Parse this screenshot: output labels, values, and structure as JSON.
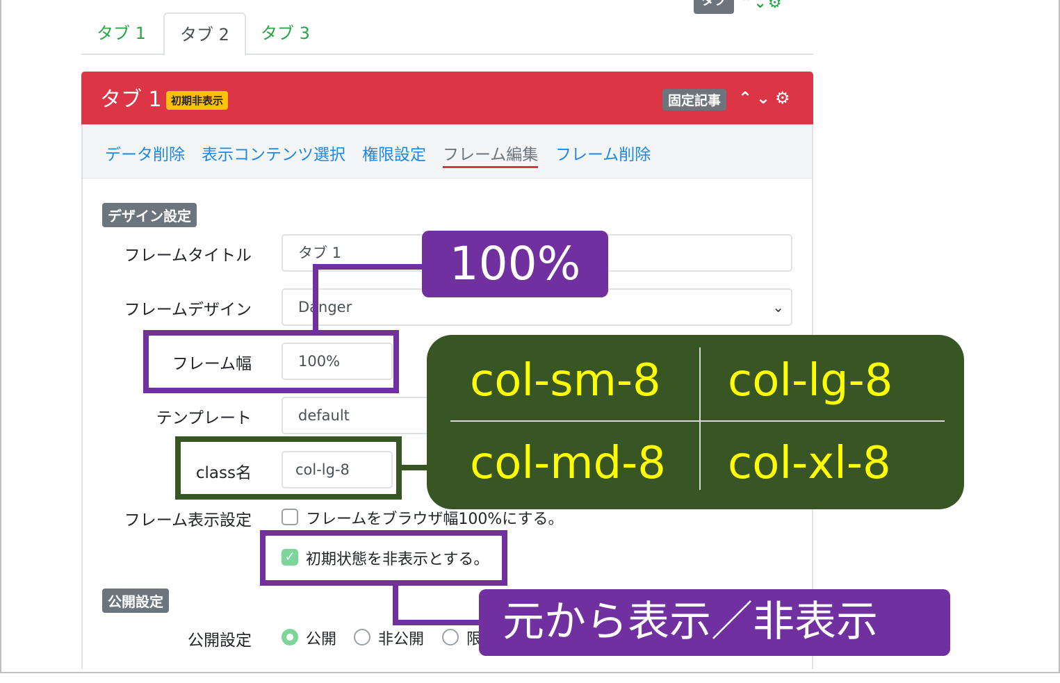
{
  "top_toolbar": {
    "badge": "タブ",
    "icons": [
      "chevron-up-icon",
      "chevron-down-icon",
      "gear-icon"
    ]
  },
  "tabs": [
    {
      "label": "タブ 1"
    },
    {
      "label": "タブ 2",
      "active": true
    },
    {
      "label": "タブ 3"
    }
  ],
  "card": {
    "header_color": "#dc3545",
    "title": "タブ 1",
    "initial_badge": "初期非表示",
    "fixed_badge": "固定記事",
    "icons": [
      "chevron-up-icon",
      "chevron-down-icon",
      "gear-icon"
    ]
  },
  "subnav": [
    {
      "label": "データ削除"
    },
    {
      "label": "表示コンテンツ選択"
    },
    {
      "label": "権限設定"
    },
    {
      "label": "フレーム編集",
      "active": true
    },
    {
      "label": "フレーム削除"
    }
  ],
  "design_section": {
    "badge": "デザイン設定",
    "frame_title": {
      "label": "フレームタイトル",
      "value": "タブ 1"
    },
    "frame_design": {
      "label": "フレームデザイン",
      "value": "Danger"
    },
    "frame_width": {
      "label": "フレーム幅",
      "value": "100%"
    },
    "template": {
      "label": "テンプレート",
      "value": "default"
    },
    "class_name": {
      "label": "class名",
      "value": "col-lg-8"
    },
    "frame_display": {
      "label": "フレーム表示設定",
      "browser_width_option": "フレームをブラウザ幅100%にする。",
      "browser_width_checked": false,
      "initial_hidden_option": "初期状態を非表示とする。",
      "initial_hidden_checked": true
    }
  },
  "public_section": {
    "badge": "公開設定",
    "label": "公開設定",
    "options": [
      {
        "label": "公開",
        "checked": true
      },
      {
        "label": "非公開",
        "checked": false
      },
      {
        "label": "限",
        "checked": false
      }
    ]
  },
  "annotations": {
    "width_callout": "100%",
    "toggle_callout": "元から表示／非表示",
    "class_examples": [
      "col-sm-8",
      "col-lg-8",
      "col-md-8",
      "col-xl-8"
    ],
    "colors": {
      "purple": "#7030a0",
      "green": "#375623",
      "yellow_text": "#ffff00"
    }
  }
}
